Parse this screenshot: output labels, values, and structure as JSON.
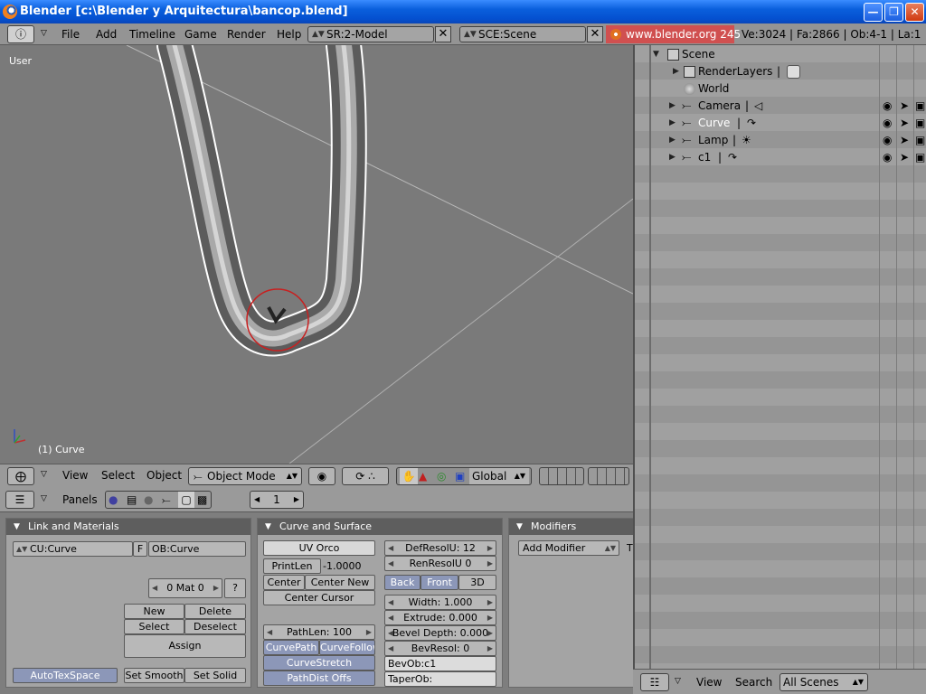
{
  "window": {
    "title": "Blender [c:\\Blender y Arquitectura\\bancop.blend]"
  },
  "menubar": {
    "items": [
      "File",
      "Add",
      "Timeline",
      "Game",
      "Render",
      "Help"
    ],
    "screen_field": "SR:2-Model",
    "scene_field": "SCE:Scene",
    "url": "www.blender.org 245",
    "stats": "Ve:3024 | Fa:2866 | Ob:4-1 | La:1"
  },
  "viewport": {
    "view_label": "User",
    "object_label": "(1) Curve"
  },
  "viewport_header": {
    "menus": [
      "View",
      "Select",
      "Object"
    ],
    "mode": "Object Mode",
    "orientation": "Global"
  },
  "buttons_header": {
    "panels_label": "Panels",
    "frame": "1"
  },
  "panels": {
    "link_materials": {
      "title": "Link and Materials",
      "cu_field": "CU:Curve",
      "f_label": "F",
      "ob_field": "OB:Curve",
      "mat": "0 Mat 0",
      "mat_q": "?",
      "new": "New",
      "delete": "Delete",
      "select": "Select",
      "deselect": "Deselect",
      "assign": "Assign",
      "autotex": "AutoTexSpace",
      "set_smooth": "Set Smooth",
      "set_solid": "Set Solid"
    },
    "curve_surface": {
      "title": "Curve and Surface",
      "uv_orco": "UV Orco",
      "printlen": "PrintLen",
      "printlen_val": "-1.0000",
      "center": "Center",
      "center_new": "Center New",
      "center_cursor": "Center Cursor",
      "pathlen": "PathLen: 100",
      "curvepath": "CurvePath",
      "curvefollow": "CurveFollow",
      "curvestretch": "CurveStretch",
      "pathdist": "PathDist Offs",
      "defresolu": "DefResolU: 12",
      "renresolu": "RenResolU 0",
      "back": "Back",
      "front": "Front",
      "three_d": "3D",
      "width": "Width: 1.000",
      "extrude": "Extrude: 0.000",
      "bevel_depth": "Bevel Depth: 0.000",
      "bevresol": "BevResol: 0",
      "bevob": "BevOb:c1",
      "taperob": "TaperOb:"
    },
    "modifiers": {
      "title": "Modifiers",
      "add_modifier": "Add Modifier",
      "cut_letter": "T"
    }
  },
  "outliner": {
    "rows": [
      {
        "name": "Scene",
        "icon": "scene-icon"
      },
      {
        "name": "RenderLayers",
        "icon": "renderlayers-icon"
      },
      {
        "name": "World",
        "icon": "world-icon"
      },
      {
        "name": "Camera",
        "icon": "camera-icon"
      },
      {
        "name": "Curve",
        "icon": "curve-icon"
      },
      {
        "name": "Lamp",
        "icon": "lamp-icon"
      },
      {
        "name": "c1",
        "icon": "curve-icon"
      }
    ]
  },
  "outliner_header": {
    "view": "View",
    "search": "Search",
    "scenes": "All Scenes"
  }
}
